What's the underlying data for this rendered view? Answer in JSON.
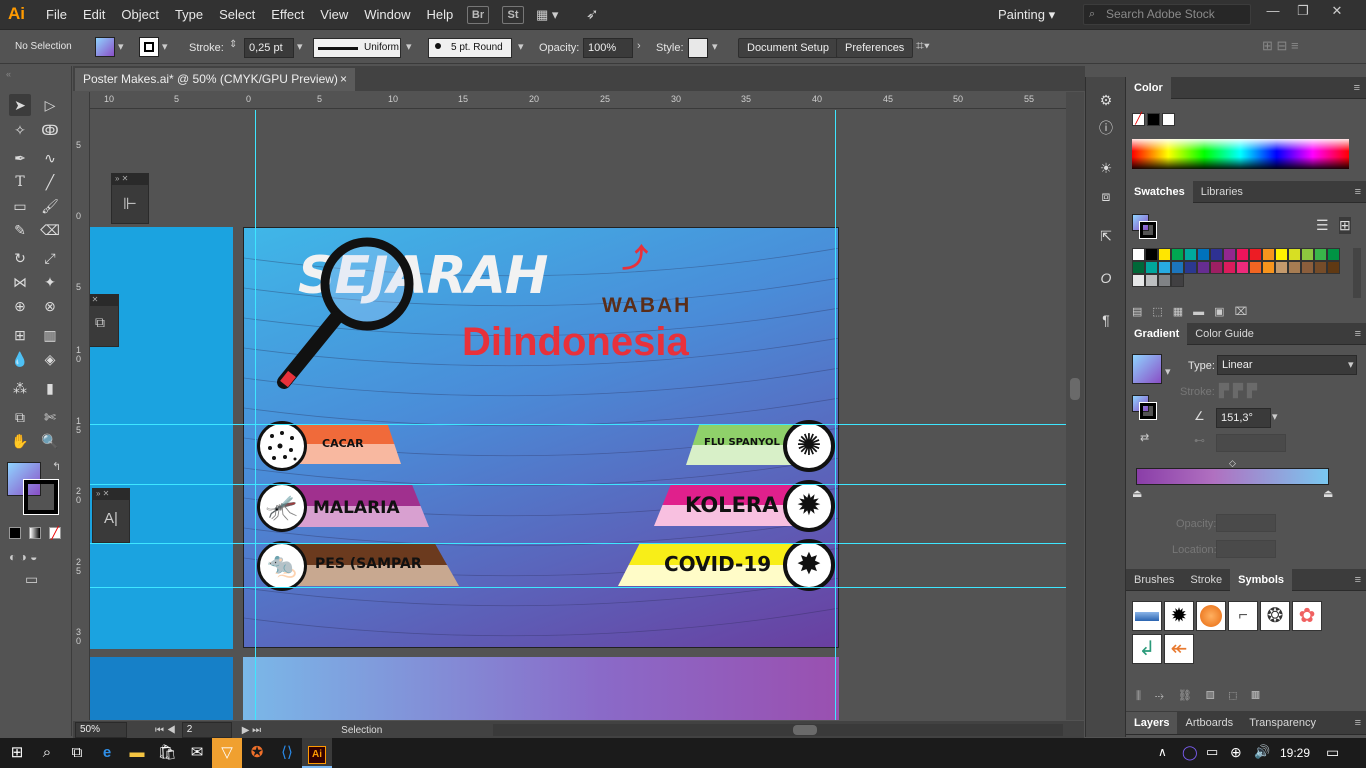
{
  "app": {
    "logo": "Ai",
    "menus": [
      "File",
      "Edit",
      "Object",
      "Type",
      "Select",
      "Effect",
      "View",
      "Window",
      "Help"
    ],
    "bridge_label": "Br",
    "stock_label": "St",
    "workspace": "Painting",
    "search_placeholder": "Search Adobe Stock"
  },
  "control": {
    "selection_status": "No Selection",
    "stroke_label": "Stroke:",
    "stroke_value": "0,25 pt",
    "profile_value": "Uniform",
    "brush_value": "5 pt. Round",
    "opacity_label": "Opacity:",
    "opacity_value": "100%",
    "style_label": "Style:",
    "doc_setup": "Document Setup",
    "preferences": "Preferences"
  },
  "document": {
    "tab_title": "Poster Makes.ai* @ 50% (CMYK/GPU Preview)",
    "close_glyph": "×"
  },
  "rulers": {
    "h_labels": [
      "10",
      "5",
      "0",
      "5",
      "10",
      "15",
      "20",
      "25",
      "30",
      "35",
      "40",
      "45",
      "50",
      "55"
    ],
    "v_labels": [
      "5",
      "0",
      "5",
      "1\n0",
      "1\n5",
      "2\n0",
      "2\n5",
      "3\n0"
    ]
  },
  "artwork": {
    "title_main": "SEJARAH",
    "title_sub": "WABAH",
    "title_region": "DiIndonesia",
    "diseases_left": [
      "CACAR",
      "MALARIA",
      "PES (SAMPAR"
    ],
    "diseases_right": [
      "FLU SPANYOL",
      "KOLERA",
      "COVID-19"
    ],
    "colors": {
      "bg_top": "#3fb7e8",
      "bg_bottom": "#6a3fa0",
      "accent_red": "#e8313b",
      "cacar": "#f06a3a",
      "malaria": "#a0308e",
      "pes": "#6b3a1e",
      "flu": "#8fd16a",
      "kolera": "#e0208c",
      "covid": "#f8ee18"
    }
  },
  "status": {
    "zoom": "50%",
    "page": "2",
    "tool": "Selection"
  },
  "panels": {
    "color_title": "Color",
    "swatches_tab": "Swatches",
    "libraries_tab": "Libraries",
    "gradient_tab": "Gradient",
    "color_guide_tab": "Color Guide",
    "type_label": "Type:",
    "type_value": "Linear",
    "stroke_label": "Stroke:",
    "angle_value": "151,3°",
    "opacity_label": "Opacity:",
    "location_label": "Location:",
    "brushes_tab": "Brushes",
    "stroke_tab": "Stroke",
    "symbols_tab": "Symbols",
    "layers_tab": "Layers",
    "artboards_tab": "Artboards",
    "transparency_tab": "Transparency",
    "swatch_colors": [
      "#ffffff",
      "#000000",
      "#ffe600",
      "#00a651",
      "#00a99d",
      "#0072bc",
      "#2e3192",
      "#92278f",
      "#ed145b",
      "#ed1c24",
      "#f7941d",
      "#fff200",
      "#d7df23",
      "#8dc63f",
      "#39b54a",
      "#009444",
      "#006838",
      "#00a79d",
      "#27aae1",
      "#1c75bc",
      "#2b388f",
      "#662d91",
      "#9e1f63",
      "#da1c5c",
      "#ee2a7b",
      "#f26522",
      "#f7941d",
      "#c49a6c",
      "#a67c52",
      "#8b5e3c",
      "#754c29",
      "#603913",
      "#e6e7e8",
      "#bcbec0",
      "#808285",
      "#414042"
    ]
  },
  "taskbar": {
    "time": "19:29"
  }
}
